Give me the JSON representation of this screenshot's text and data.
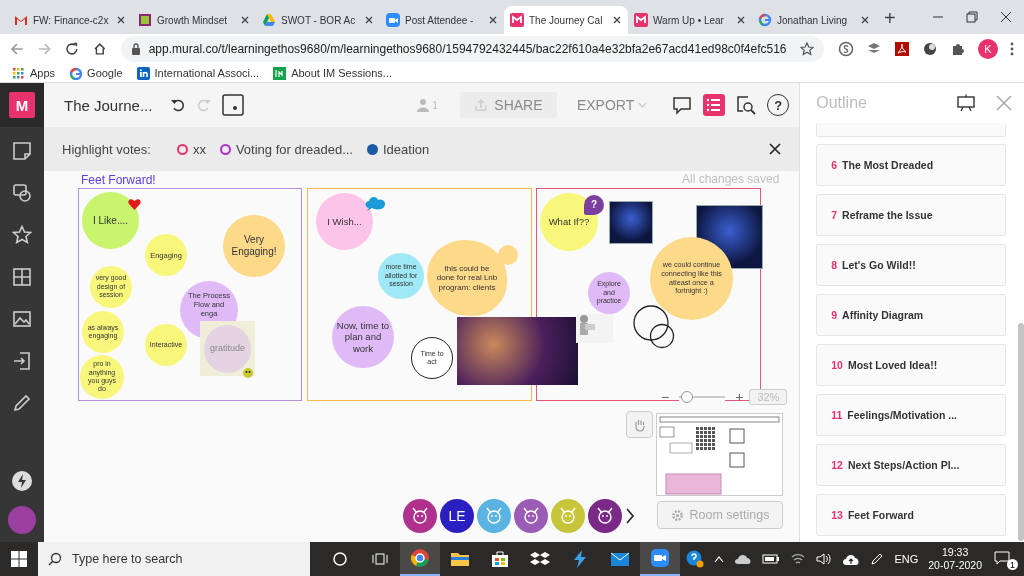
{
  "browser": {
    "tabs": [
      {
        "kind": "gmail",
        "title": "FW: Finance-c2x",
        "selected": false
      },
      {
        "kind": "growth",
        "title": "Growth Mindset",
        "selected": false
      },
      {
        "kind": "drive",
        "title": "SWOT - BOR Ac",
        "selected": false
      },
      {
        "kind": "zoom",
        "title": "Post Attendee -",
        "selected": false
      },
      {
        "kind": "mural",
        "title": "The Journey Cal",
        "selected": true
      },
      {
        "kind": "mural",
        "title": "Warm Up • Lear",
        "selected": false
      },
      {
        "kind": "google",
        "title": "Jonathan Living",
        "selected": false
      }
    ],
    "new_tab": "+",
    "address": "app.mural.co/t/learningethos9680/m/learningethos9680/1594792432445/bac22f610a4e32bfa2e67acd41ed98c0f4efc516",
    "profile": "K",
    "bookmarks": [
      {
        "kind": "apps",
        "label": "Apps"
      },
      {
        "kind": "google",
        "label": "Google"
      },
      {
        "kind": "linkedin",
        "label": "International Associ..."
      },
      {
        "kind": "im",
        "label": "About IM Sessions..."
      }
    ]
  },
  "app": {
    "logo": "M",
    "title": "The Journe...",
    "user_count": "1",
    "share": "SHARE",
    "export": "EXPORT",
    "toolbar_buttons": [
      {
        "kind": "comment",
        "selected": false
      },
      {
        "kind": "outline",
        "selected": true
      },
      {
        "kind": "search",
        "selected": false
      },
      {
        "kind": "help",
        "label": "?",
        "selected": false
      }
    ],
    "votes": {
      "label": "Highlight votes:",
      "items": [
        {
          "label": "xx",
          "color": "#e8326c",
          "selected": false
        },
        {
          "label": "Voting for dreaded...",
          "color": "#b02fc8",
          "selected": false
        },
        {
          "label": "Ideation",
          "color": "#1d5aa3",
          "selected": true
        }
      ]
    },
    "canvas": {
      "title": "Feet Forward!",
      "status": "All changes saved",
      "frames": [
        {
          "color": "#b68ed6"
        },
        {
          "color": "#f5b84a"
        },
        {
          "color": "#e8557a"
        }
      ],
      "notes": [
        {
          "kind": "circle",
          "text": "I Like....",
          "color": "#c9f56e"
        },
        {
          "kind": "circle",
          "text": "Engaging",
          "color": "#f8f77c"
        },
        {
          "kind": "circle",
          "text": "Very Engaging!",
          "color": "#fdd98a"
        },
        {
          "kind": "circle",
          "text": "very good design of session",
          "color": "#f8f77c"
        },
        {
          "kind": "circle",
          "text": "as always engaging",
          "color": "#f8f77c"
        },
        {
          "kind": "circle",
          "text": "Interactive",
          "color": "#f8f77c"
        },
        {
          "kind": "circle",
          "text": "pro in anything you guys do",
          "color": "#f8f77c"
        },
        {
          "kind": "circle",
          "text": "The Process Flow and enga",
          "color": "#dfbaf7"
        },
        {
          "kind": "square",
          "text": "gratitude",
          "color": "#e4d3e2"
        },
        {
          "kind": "circle",
          "text": "I Wish...",
          "color": "#fdc4e9"
        },
        {
          "kind": "circle",
          "text": "more time allotted for session",
          "color": "#9fe8f8"
        },
        {
          "kind": "blob",
          "text": "this could be done for real Lnb program: clients",
          "color": "#fdd98a"
        },
        {
          "kind": "circle",
          "text": "Now, time to plan and work",
          "color": "#dfbaf7"
        },
        {
          "kind": "ring",
          "text": "Time to act",
          "color": "#222222"
        },
        {
          "kind": "circle",
          "text": "What If??",
          "color": "#f8f77c"
        },
        {
          "kind": "bubble",
          "text": "?",
          "color": "#7b3fa0"
        },
        {
          "kind": "circle",
          "text": "we could continue connecting like this atleast once a fortnight :)",
          "color": "#fdd98a"
        },
        {
          "kind": "circle",
          "text": "Explore and practice",
          "color": "#dfbaf7"
        }
      ]
    },
    "zoom": {
      "out": "−",
      "in": "+",
      "value": "32%",
      "slider": {
        "level": 0.15
      }
    },
    "room_settings": "Room settings",
    "collaborators": [
      {
        "color": "#b0308e"
      },
      {
        "initials": "LE",
        "color": "#2a1fc0"
      },
      {
        "color": "#5ab3e0"
      },
      {
        "color": "#9a5cb4"
      },
      {
        "color": "#c7c53a"
      },
      {
        "color": "#7a2a86"
      }
    ],
    "outline": {
      "title": "Outline",
      "items": [
        {
          "number": "6",
          "title": "The Most Dreaded"
        },
        {
          "number": "7",
          "title": "Reframe the Issue"
        },
        {
          "number": "8",
          "title": "Let's Go Wild!!"
        },
        {
          "number": "9",
          "title": "Affinity Diagram"
        },
        {
          "number": "10",
          "title": "Most Loved Idea!!"
        },
        {
          "number": "11",
          "title": "Feelings/Motivation ..."
        },
        {
          "number": "12",
          "title": "Next Steps/Action Pl..."
        },
        {
          "number": "13",
          "title": "Feet Forward"
        }
      ]
    }
  },
  "taskbar": {
    "search_placeholder": "Type here to search",
    "apps": [
      {
        "kind": "chrome",
        "selected": true
      },
      {
        "kind": "explorer",
        "selected": false
      },
      {
        "kind": "store",
        "selected": false
      },
      {
        "kind": "dropbox",
        "selected": false
      },
      {
        "kind": "bolt",
        "selected": false
      },
      {
        "kind": "mail",
        "selected": false
      },
      {
        "kind": "zoom",
        "selected": true
      }
    ],
    "language": "ENG",
    "time": "19:33",
    "date": "20-07-2020",
    "notifications": "1"
  }
}
